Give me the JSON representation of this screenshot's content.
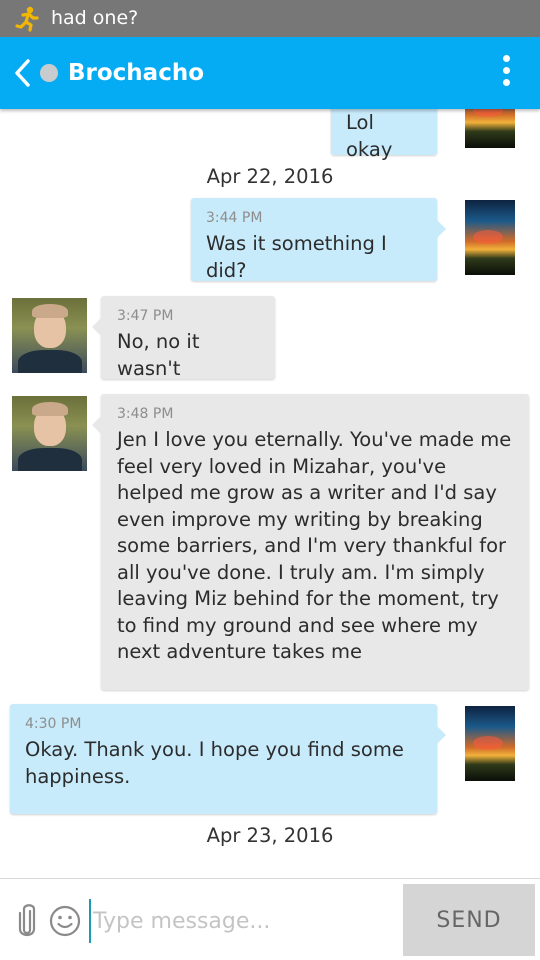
{
  "status_bar": {
    "text": "had one?",
    "icon": "running-person-icon"
  },
  "header": {
    "back_icon": "chevron-left-icon",
    "presence_icon": "presence-dot-icon",
    "title": "Brochacho",
    "menu_icon": "vertical-dots-icon",
    "color": "#06acf3"
  },
  "conversation": {
    "m1": {
      "direction": "outgoing",
      "text": "Lol okay"
    },
    "date1": "Apr 22, 2016",
    "m2": {
      "direction": "outgoing",
      "time": "3:44 PM",
      "text": "Was it something I did?"
    },
    "m3": {
      "direction": "incoming",
      "time": "3:47 PM",
      "text": "No, no it wasn't"
    },
    "m4": {
      "direction": "incoming",
      "time": "3:48 PM",
      "text": "Jen I love you eternally. You've made me feel very loved in Mizahar, you've helped me grow as a writer and I'd say even improve my writing by breaking some barriers, and I'm very thankful for all you've done. I truly am. I'm simply leaving Miz behind for the moment, try to find my ground and see where my next adventure takes me"
    },
    "m5": {
      "direction": "outgoing",
      "time": "4:30 PM",
      "text": "Okay. Thank you. I hope you find some happiness."
    },
    "date2": "Apr 23, 2016"
  },
  "colors": {
    "outgoing_bubble": "#c8ebfb",
    "incoming_bubble": "#e8e8e8"
  },
  "composer": {
    "attach_icon": "paperclip-icon",
    "emoji_icon": "smiley-icon",
    "placeholder": "Type message...",
    "value": "",
    "send_label": "SEND"
  }
}
